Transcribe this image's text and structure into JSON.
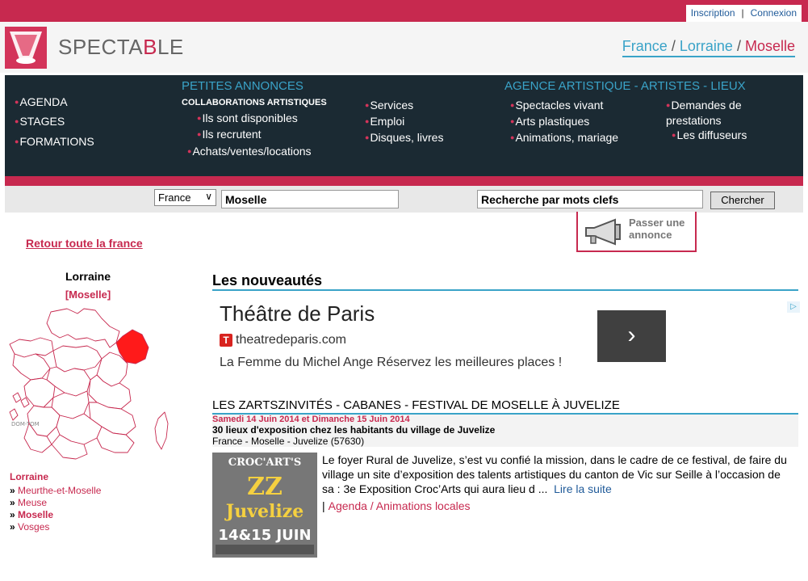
{
  "auth": {
    "signup": "Inscription",
    "separator": "|",
    "login": "Connexion"
  },
  "brand": {
    "name_a": "SPECTA",
    "name_b": "B",
    "name_c": "LE"
  },
  "breadcrumb": {
    "country": "France",
    "sep1": "/",
    "region": "Lorraine",
    "sep2": "/",
    "department": "Moselle"
  },
  "nav": {
    "left": [
      "AGENDA",
      "STAGES",
      "FORMATIONS"
    ],
    "classifieds_title": "PETITES ANNONCES",
    "collab_title": "COLLABORATIONS ARTISTIQUES",
    "collab_items": [
      "Ils sont disponibles",
      "Ils recrutent",
      "Achats/ventes/locations"
    ],
    "services_items": [
      "Services",
      "Emploi",
      "Disques, livres"
    ],
    "agency_title": "AGENCE ARTISTIQUE - ARTISTES - LIEUX",
    "agency_items": [
      "Spectacles vivant",
      "Arts plastiques",
      "Animations, mariage"
    ],
    "agency_right": [
      "Demandes de prestations",
      "Les diffuseurs"
    ]
  },
  "search": {
    "country_selected": "France",
    "location_value": "Moselle",
    "keywords_value": "Recherche par mots clefs",
    "submit_label": "Chercher"
  },
  "post_ad": {
    "line1": "Passer une",
    "line2": "annonce"
  },
  "sidebar": {
    "back_link": "Retour toute la france",
    "region_name": "Lorraine",
    "department_tag": "[Moselle]",
    "map_label": "DOM-TOM",
    "list_title": "Lorraine",
    "departments": [
      "Meurthe-et-Moselle",
      "Meuse",
      "Moselle",
      "Vosges"
    ],
    "bullet": "»"
  },
  "main": {
    "section_title": "Les nouveautés",
    "ad": {
      "title": "Théâtre de Paris",
      "site_letter": "T",
      "site": "theatredeparis.com",
      "desc": "La Femme du Michel Ange Réservez les meilleures places !",
      "arrow": "›"
    },
    "event": {
      "title": "LES ZARTSZINVITÉS - CABANES - FESTIVAL DE MOSELLE À JUVELIZE",
      "date": "Samedi 14 Juin 2014 et Dimanche 15 Juin 2014",
      "subtitle": "30 lieux d'exposition chez les habitants du village de Juvelize",
      "location": "France - Moselle - Juvelize (57630)",
      "text": "Le foyer Rural de Juvelize, s’est vu confié la mission, dans le cadre de ce festival, de faire du village un site d’exposition des talents artistiques du canton de Vic sur Seille à l’occasion de sa : 3e Exposition Croc’Arts qui aura lieu d ...",
      "read_more": "Lire la suite",
      "category_sep": "|",
      "category": "Agenda / Animations locales",
      "poster": {
        "line1": "CROC'ART'S",
        "line2": "ZZ",
        "line3": "Juvelize",
        "line4": "14&15 JUIN"
      }
    }
  },
  "colors": {
    "accent": "#c7294f",
    "nav_bg": "#1b2a33",
    "link_blue": "#3aa3c8"
  }
}
